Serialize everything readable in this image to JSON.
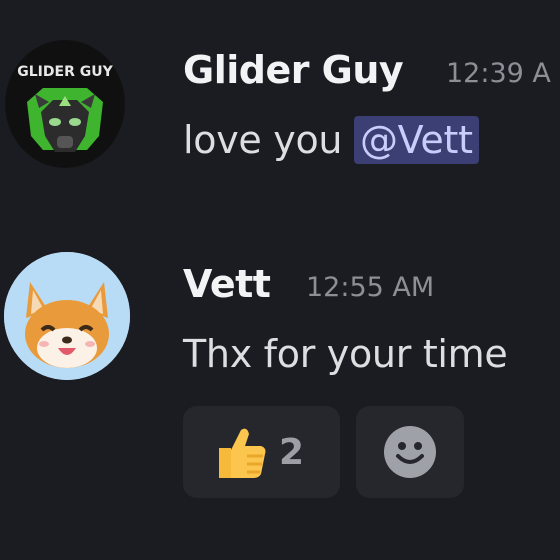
{
  "messages": [
    {
      "author": "Glider Guy",
      "timestamp": "12:39 A",
      "content": "love you ",
      "mention": "@Vett",
      "avatar_icon": "glider-guy-avatar-icon",
      "avatar_text": "GLIDER GUY"
    },
    {
      "author": "Vett",
      "timestamp": "12:55 AM",
      "content": "Thx for your time",
      "avatar_icon": "fox-avatar-icon",
      "reactions": [
        {
          "emoji": "thumbs-up-icon",
          "count": "2"
        }
      ],
      "add_reaction_icon": "add-reaction-smile-icon"
    }
  ],
  "colors": {
    "background": "#1b1c21",
    "mention_bg": "#3b3f73",
    "reaction_bg": "#26272d"
  }
}
